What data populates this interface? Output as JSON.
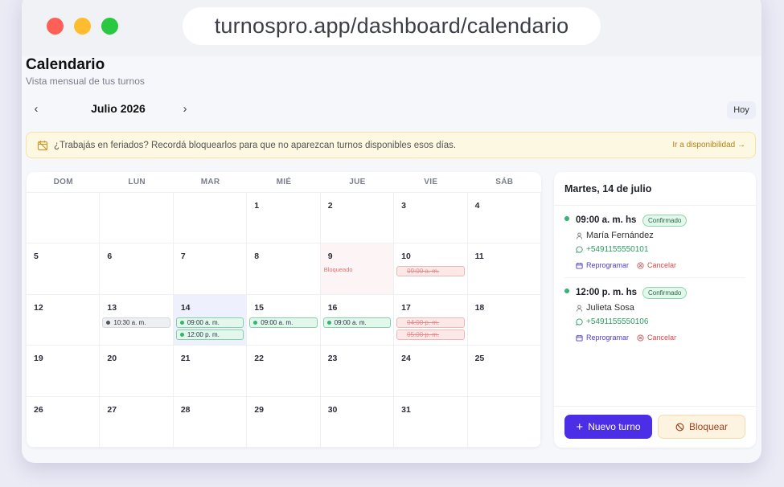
{
  "browser": {
    "url": "turnospro.app/dashboard/calendario"
  },
  "header": {
    "title": "Calendario",
    "subtitle": "Vista mensual de tus turnos"
  },
  "month_nav": {
    "prev_icon": "‹",
    "label": "Julio 2026",
    "next_icon": "›",
    "today_label": "Hoy"
  },
  "banner": {
    "text": "¿Trabajás en feriados? Recordá bloquearlos para que no aparezcan turnos disponibles esos días.",
    "link": "Ir a disponibilidad →"
  },
  "calendar": {
    "weekdays": [
      "DOM",
      "LUN",
      "MAR",
      "MIÉ",
      "JUE",
      "VIE",
      "SÁB"
    ],
    "days": [
      {
        "n": ""
      },
      {
        "n": ""
      },
      {
        "n": ""
      },
      {
        "n": "1"
      },
      {
        "n": "2"
      },
      {
        "n": "3"
      },
      {
        "n": "4"
      },
      {
        "n": "5"
      },
      {
        "n": "6"
      },
      {
        "n": "7"
      },
      {
        "n": "8"
      },
      {
        "n": "9",
        "blocked": true,
        "blocked_label": "Bloqueado"
      },
      {
        "n": "10",
        "chips": [
          {
            "t": "09:00 a. m.",
            "s": "red"
          }
        ]
      },
      {
        "n": "11"
      },
      {
        "n": "12"
      },
      {
        "n": "13",
        "chips": [
          {
            "t": "10:30 a. m.",
            "s": "gray"
          }
        ]
      },
      {
        "n": "14",
        "selected": true,
        "chips": [
          {
            "t": "09:00 a. m.",
            "s": "green"
          },
          {
            "t": "12:00 p. m.",
            "s": "green"
          }
        ]
      },
      {
        "n": "15",
        "chips": [
          {
            "t": "09:00 a. m.",
            "s": "green"
          }
        ]
      },
      {
        "n": "16",
        "chips": [
          {
            "t": "09:00 a. m.",
            "s": "green"
          }
        ]
      },
      {
        "n": "17",
        "chips": [
          {
            "t": "04:00 p. m.",
            "s": "red"
          },
          {
            "t": "05:00 p. m.",
            "s": "red"
          }
        ]
      },
      {
        "n": "18"
      },
      {
        "n": "19"
      },
      {
        "n": "20"
      },
      {
        "n": "21"
      },
      {
        "n": "22"
      },
      {
        "n": "23"
      },
      {
        "n": "24"
      },
      {
        "n": "25"
      },
      {
        "n": "26"
      },
      {
        "n": "27"
      },
      {
        "n": "28"
      },
      {
        "n": "29"
      },
      {
        "n": "30"
      },
      {
        "n": "31"
      },
      {
        "n": ""
      }
    ]
  },
  "panel": {
    "title": "Martes, 14 de julio",
    "appointments": [
      {
        "time": "09:00 a. m. hs",
        "status": "Confirmado",
        "name": "María Fernández",
        "phone": "+5491155550101",
        "reschedule": "Reprogramar",
        "cancel": "Cancelar"
      },
      {
        "time": "12:00 p. m. hs",
        "status": "Confirmado",
        "name": "Julieta Sosa",
        "phone": "+5491155550106",
        "reschedule": "Reprogramar",
        "cancel": "Cancelar"
      }
    ],
    "new_button": "Nuevo turno",
    "block_button": "Bloquear"
  },
  "colors": {
    "accent": "#4b2ee6",
    "confirmed": "#36b36e",
    "blocked": "#e58a8a",
    "warning_bg": "#fdf8e2"
  }
}
